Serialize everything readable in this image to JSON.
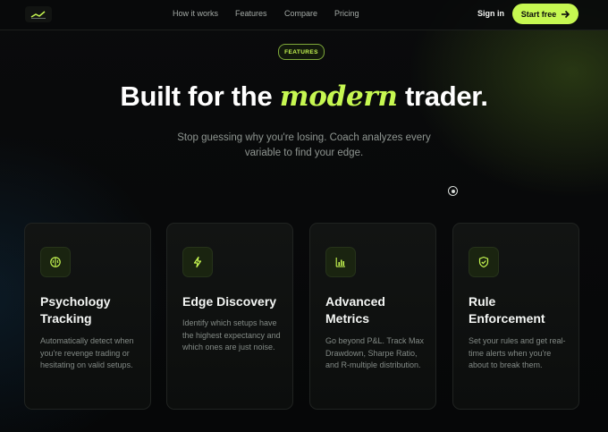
{
  "nav": {
    "links": [
      "How it works",
      "Features",
      "Compare",
      "Pricing"
    ],
    "signin": "Sign in",
    "cta": "Start free"
  },
  "hero": {
    "badge": "FEATURES",
    "headline_pre": "Built for the ",
    "headline_accent": "modern",
    "headline_post": " trader.",
    "subtitle": "Stop guessing why you're losing. Coach analyzes every variable to find your edge."
  },
  "cards": [
    {
      "icon": "brain-icon",
      "title": "Psychology Tracking",
      "desc": "Automatically detect when you're revenge trading or hesitating on valid setups."
    },
    {
      "icon": "lightning-icon",
      "title": "Edge Discovery",
      "desc": "Identify which setups have the highest expectancy and which ones are just noise."
    },
    {
      "icon": "bar-chart-icon",
      "title": "Advanced Metrics",
      "desc": "Go beyond P&L. Track Max Drawdown, Sharpe Ratio, and R-multiple distribution."
    },
    {
      "icon": "shield-check-icon",
      "title": "Rule Enforcement",
      "desc": "Set your rules and get real-time alerts when you're about to break them."
    }
  ],
  "colors": {
    "accent": "#c6f751",
    "background": "#08090a",
    "card": "#111312"
  }
}
